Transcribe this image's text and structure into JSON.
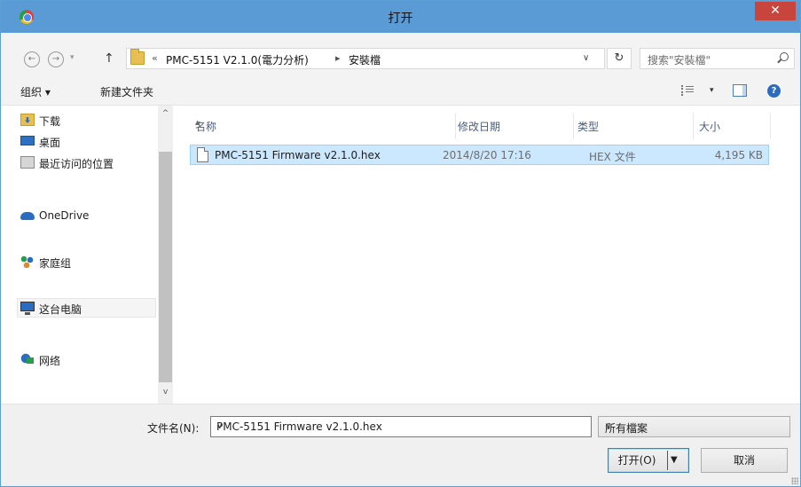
{
  "window": {
    "title": "打开",
    "close_glyph": "✕"
  },
  "address_bar": {
    "back_glyph": "←",
    "forward_glyph": "→",
    "up_glyph": "↑",
    "overflow_glyph": "«",
    "crumbs": [
      "PMC-5151 V2.1.0(電力分析)",
      "安裝檔"
    ],
    "crumb_separator": "▸",
    "dropdown_glyph": "∨",
    "refresh_glyph": "↻",
    "search_placeholder": "搜索\"安裝檔\""
  },
  "command_bar": {
    "organize_label": "组织 ▾",
    "new_folder_label": "新建文件夹",
    "view_dropdown_glyph": "▾",
    "help_glyph": "?"
  },
  "nav_pane": {
    "items": [
      {
        "label": "下载",
        "icon": "download-folder-icon"
      },
      {
        "label": "桌面",
        "icon": "desktop-icon"
      },
      {
        "label": "最近访问的位置",
        "icon": "recent-places-icon"
      },
      {
        "label": "OneDrive",
        "icon": "onedrive-icon"
      },
      {
        "label": "家庭组",
        "icon": "homegroup-icon"
      },
      {
        "label": "这台电脑",
        "icon": "this-pc-icon"
      },
      {
        "label": "网络",
        "icon": "network-icon"
      }
    ],
    "scroll_up_glyph": "^",
    "scroll_down_glyph": "v"
  },
  "file_list": {
    "columns": [
      "名称",
      "修改日期",
      "类型",
      "大小"
    ],
    "sort_glyph": "▲",
    "rows": [
      {
        "name": "PMC-5151 Firmware v2.1.0.hex",
        "modified": "2014/8/20 17:16",
        "type": "HEX 文件",
        "size": "4,195 KB"
      }
    ]
  },
  "bottom": {
    "filename_label": "文件名(N):",
    "filename_value": "PMC-5151 Firmware v2.1.0.hex",
    "dropdown_glyph": "∨",
    "filetype_value": "所有檔案",
    "open_label": "打开(O)",
    "open_dropdown_glyph": "▼",
    "cancel_label": "取消"
  },
  "colors": {
    "titlebar": "#5a9ad5",
    "close_button": "#c7453c",
    "selection": "#cce8ff",
    "selection_border": "#99d1ff"
  }
}
